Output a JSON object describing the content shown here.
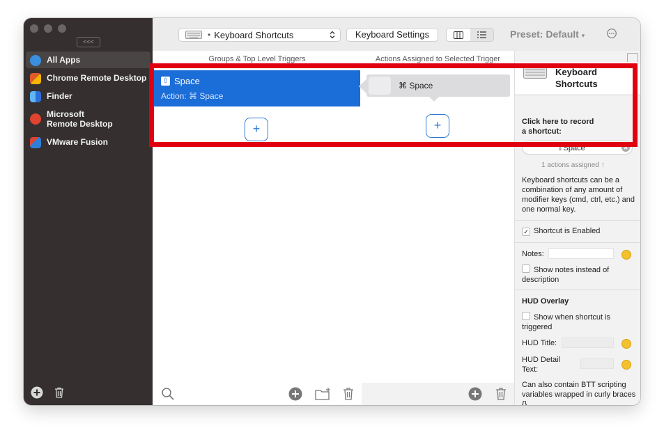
{
  "sidebar": {
    "collapse_label": "<<<",
    "apps": [
      {
        "label": "All Apps",
        "icon": "globe-icon",
        "color": "#3a8fe0"
      },
      {
        "label": "Chrome Remote Desktop",
        "icon": "chrome-remote-desktop-icon",
        "color": "#e05a2a"
      },
      {
        "label": "Finder",
        "icon": "finder-icon",
        "color": "#3c8ef0"
      },
      {
        "label": "Microsoft\nRemote Desktop",
        "icon": "remote-desktop-icon",
        "color": "#e0432f"
      },
      {
        "label": "VMware Fusion",
        "icon": "vmware-icon",
        "color": "#2f7fd8"
      }
    ]
  },
  "toolbar": {
    "select_value": "Keyboard Shortcuts",
    "settings_label": "Keyboard Settings",
    "preset_label": "Preset: Default"
  },
  "triggers": {
    "header": "Groups & Top Level Triggers",
    "item_title": "Space",
    "item_subtitle": "Action: ⌘ Space",
    "add_label": "+"
  },
  "actions": {
    "header": "Actions Assigned to Selected Trigger",
    "item_label": "⌘ Space",
    "add_label": "+"
  },
  "panel": {
    "title_line1": "Keyboard",
    "title_line2": "Shortcuts",
    "record_label_1": "Click here to record",
    "record_label_2": "a shortcut:",
    "shortcut_value": "⇧Space",
    "actions_assigned": "1 actions assigned ↑",
    "description": "Keyboard shortcuts can be a combination of any amount of modifier keys (cmd, ctrl, etc.) and one normal key.",
    "enabled_label": "Shortcut is Enabled",
    "notes_label": "Notes:",
    "show_notes_label": "Show notes instead of description",
    "hud_heading": "HUD Overlay",
    "hud_show_label": "Show when shortcut is triggered",
    "hud_title_label": "HUD Title:",
    "hud_detail_label": "HUD Detail Text:",
    "hud_note": "Can also contain BTT scripting variables wrapped in curly braces {}"
  },
  "colors": {
    "selection": "#1b6dd8",
    "highlight": "#e0000f",
    "sidebar": "#352f2f"
  }
}
